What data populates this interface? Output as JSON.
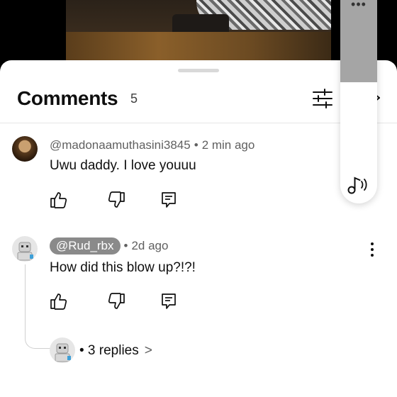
{
  "comments_panel": {
    "title": "Comments",
    "count": "5"
  },
  "comments": [
    {
      "author": "@madonaamuthasini3845",
      "separator": "•",
      "time": "2 min ago",
      "text": "Uwu daddy. I love youuu"
    },
    {
      "author": "@Rud_rbx",
      "separator": "•",
      "time": "2d ago",
      "text": "How did this blow up?!?!",
      "replies_label": "• 3 replies",
      "replies_chevron": ">"
    }
  ],
  "overlay": {
    "dots": "•••"
  },
  "icons": {
    "filter": "sliders-icon",
    "close": "close-icon",
    "like": "thumbs-up-icon",
    "dislike": "thumbs-down-icon",
    "reply": "reply-icon",
    "more": "vertical-dots-icon",
    "sound": "music-note-icon"
  },
  "colors": {
    "sheet_background": "#ffffff",
    "chip_background": "#8a8a8a",
    "secondary_text": "#606060"
  }
}
